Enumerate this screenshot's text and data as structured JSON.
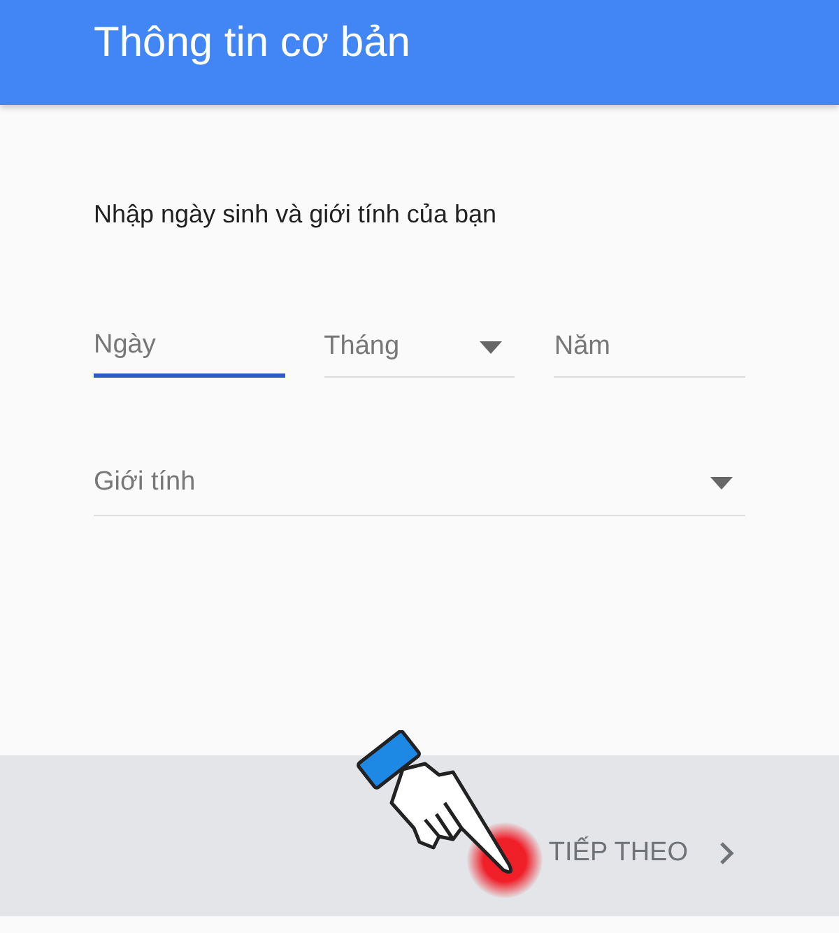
{
  "header": {
    "title": "Thông tin cơ bản"
  },
  "prompt": "Nhập ngày sinh và giới tính của bạn",
  "date_fields": [
    {
      "placeholder": "Ngày",
      "kind": "text",
      "focused": true
    },
    {
      "placeholder": "Tháng",
      "kind": "dropdown",
      "focused": false
    },
    {
      "placeholder": "Năm",
      "kind": "text",
      "focused": false
    }
  ],
  "gender_field": {
    "placeholder": "Giới tính",
    "kind": "dropdown",
    "focused": false
  },
  "footer": {
    "next_button": "TIẾP THEO"
  }
}
